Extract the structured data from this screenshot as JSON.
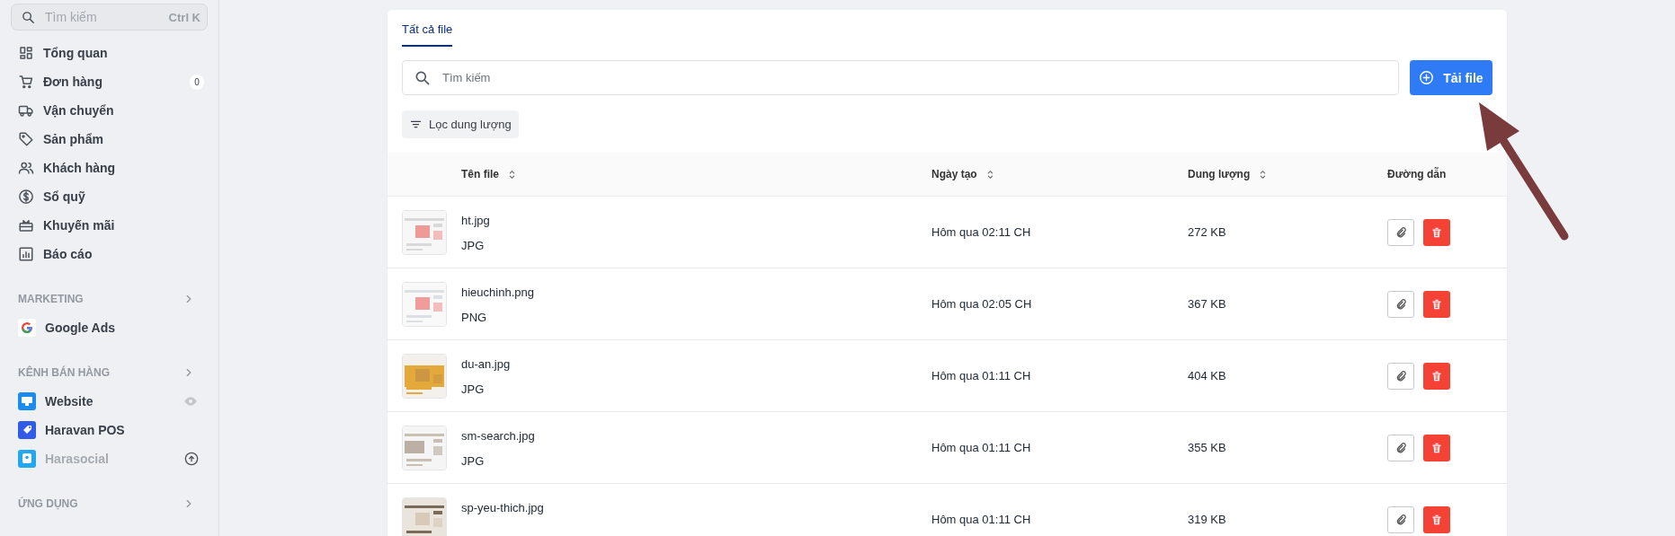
{
  "sidebar": {
    "search": {
      "placeholder": "Tìm kiếm",
      "shortcut": "Ctrl K"
    },
    "items": [
      {
        "label": "Tổng quan"
      },
      {
        "label": "Đơn hàng",
        "badge": "0"
      },
      {
        "label": "Vận chuyển"
      },
      {
        "label": "Sản phẩm"
      },
      {
        "label": "Khách hàng"
      },
      {
        "label": "Sổ quỹ"
      },
      {
        "label": "Khuyến mãi"
      },
      {
        "label": "Báo cáo"
      }
    ],
    "sections": [
      {
        "title": "MARKETING",
        "items": [
          {
            "label": "Google Ads",
            "disabled": false
          }
        ]
      },
      {
        "title": "KÊNH BÁN HÀNG",
        "items": [
          {
            "label": "Website",
            "disabled": false
          },
          {
            "label": "Haravan POS",
            "disabled": false
          },
          {
            "label": "Harasocial",
            "disabled": true
          }
        ]
      },
      {
        "title": "ỨNG DỤNG"
      }
    ]
  },
  "tabs": [
    {
      "label": "Tất cả file",
      "selected": true
    }
  ],
  "search": {
    "placeholder": "Tìm kiếm"
  },
  "upload_button": "Tải file",
  "filter_button": "Lọc dung lượng",
  "table": {
    "columns": [
      {
        "label": "Tên file",
        "sortable": true
      },
      {
        "label": "Ngày tạo",
        "sortable": true
      },
      {
        "label": "Dung lượng",
        "sortable": true
      },
      {
        "label": "Đường dẫn",
        "sortable": false
      }
    ],
    "rows": [
      {
        "name": "ht.jpg",
        "type": "JPG",
        "created": "Hôm qua 02:11 CH",
        "size": "272 KB"
      },
      {
        "name": "hieuchinh.png",
        "type": "PNG",
        "created": "Hôm qua 02:05 CH",
        "size": "367 KB"
      },
      {
        "name": "du-an.jpg",
        "type": "JPG",
        "created": "Hôm qua 01:11 CH",
        "size": "404 KB"
      },
      {
        "name": "sm-search.jpg",
        "type": "JPG",
        "created": "Hôm qua 01:11 CH",
        "size": "355 KB"
      },
      {
        "name": "sp-yeu-thich.jpg",
        "created": "Hôm qua 01:11 CH",
        "size": "319 KB"
      }
    ]
  }
}
